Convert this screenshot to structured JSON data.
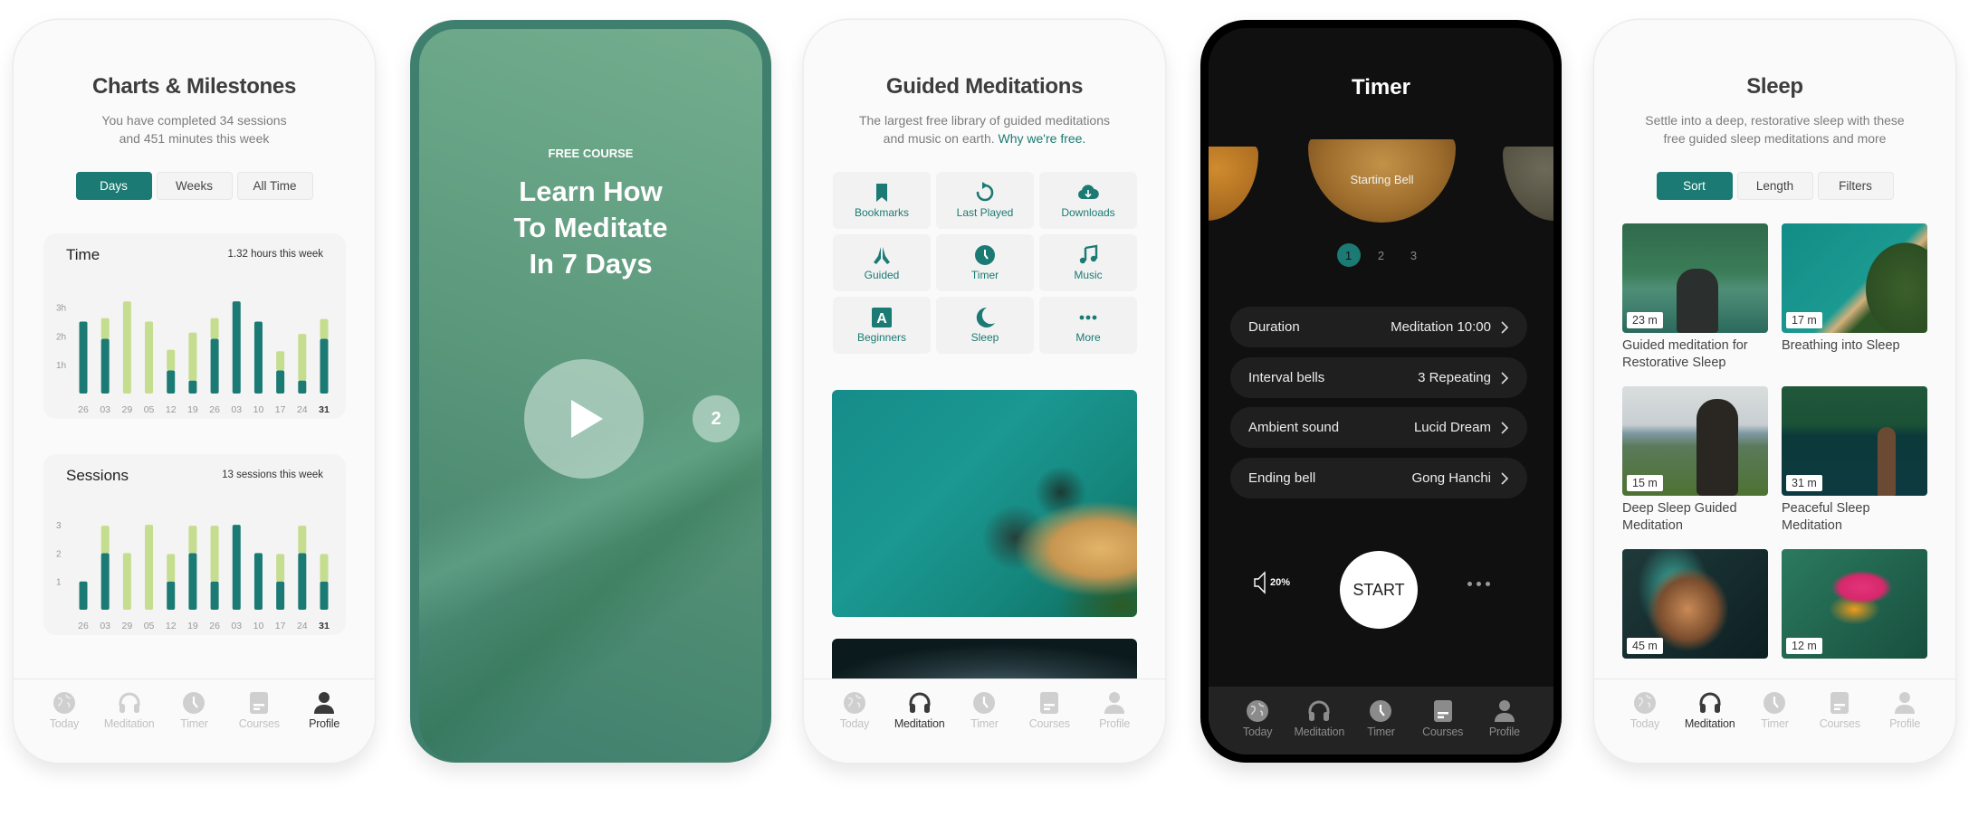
{
  "tabbar": {
    "items": [
      {
        "label": "Today",
        "icon": "globe-icon"
      },
      {
        "label": "Meditation",
        "icon": "headphones-icon"
      },
      {
        "label": "Timer",
        "icon": "clock-icon"
      },
      {
        "label": "Courses",
        "icon": "courses-icon"
      },
      {
        "label": "Profile",
        "icon": "profile-icon"
      }
    ]
  },
  "charts_screen": {
    "title": "Charts & Milestones",
    "subtitle_line1": "You have completed 34 sessions",
    "subtitle_line2": "and 451 minutes this week",
    "segments": [
      "Days",
      "Weeks",
      "All Time"
    ],
    "active_segment": "Days",
    "active_tab": "Profile"
  },
  "chart_data": [
    {
      "type": "bar",
      "title": "Time",
      "annotation": "1.32 hours this week",
      "categories": [
        "26",
        "03",
        "29",
        "05",
        "12",
        "19",
        "26",
        "03",
        "10",
        "17",
        "24",
        "31"
      ],
      "highlight_category_index": 11,
      "stacked": true,
      "yticks": [
        "1h",
        "2h",
        "3h"
      ],
      "ylim": [
        0,
        3.3
      ],
      "series": [
        {
          "name": "dark",
          "color": "#1b7a73",
          "values": [
            2.5,
            1.9,
            0,
            0,
            0.8,
            0.45,
            1.9,
            3.2,
            2.5,
            0.8,
            0.45,
            1.9
          ]
        },
        {
          "name": "light",
          "color": "#c5dd8e",
          "values": [
            0,
            0.75,
            3.2,
            2.5,
            0.75,
            1.7,
            0.75,
            0,
            0,
            0.7,
            1.65,
            0.72
          ]
        }
      ],
      "xlabel": "",
      "ylabel": ""
    },
    {
      "type": "bar",
      "title": "Sessions",
      "annotation": "13 sessions this week",
      "categories": [
        "26",
        "03",
        "29",
        "05",
        "12",
        "19",
        "26",
        "03",
        "10",
        "17",
        "24",
        "31"
      ],
      "highlight_category_index": 11,
      "stacked": true,
      "yticks": [
        "1",
        "2",
        "3"
      ],
      "ylim": [
        0,
        3.1
      ],
      "series": [
        {
          "name": "dark",
          "color": "#1b7a73",
          "values": [
            1,
            2,
            0,
            0,
            1,
            2,
            1,
            3,
            2,
            1,
            2,
            1
          ]
        },
        {
          "name": "light",
          "color": "#c5dd8e",
          "values": [
            0,
            1,
            2,
            3,
            1,
            1,
            2,
            0,
            0,
            1,
            1,
            1
          ]
        }
      ],
      "xlabel": "",
      "ylabel": ""
    }
  ],
  "course_screen": {
    "eyebrow": "FREE COURSE",
    "title_lines": [
      "Learn How",
      "To Meditate",
      "In 7 Days"
    ],
    "next_badge": "2",
    "play_icon": "play-icon"
  },
  "guided_screen": {
    "title": "Guided Meditations",
    "subtitle_line1": "The largest free library of guided meditations",
    "subtitle_line2": "and music on earth.",
    "link": "Why we're free.",
    "categories": [
      {
        "label": "Bookmarks",
        "icon": "bookmark-icon"
      },
      {
        "label": "Last Played",
        "icon": "history-icon"
      },
      {
        "label": "Downloads",
        "icon": "cloud-download-icon"
      },
      {
        "label": "Guided",
        "icon": "praying-hands-icon"
      },
      {
        "label": "Timer",
        "icon": "clock-icon"
      },
      {
        "label": "Music",
        "icon": "music-note-icon"
      },
      {
        "label": "Beginners",
        "icon": "letter-a-icon"
      },
      {
        "label": "Sleep",
        "icon": "moon-icon"
      },
      {
        "label": "More",
        "icon": "more-icon"
      }
    ],
    "active_tab": "Meditation"
  },
  "timer_screen": {
    "title": "Timer",
    "bell_label": "Starting Bell",
    "pager": [
      "1",
      "2",
      "3"
    ],
    "active_page": "1",
    "settings": [
      {
        "label": "Duration",
        "value": "Meditation 10:00"
      },
      {
        "label": "Interval bells",
        "value": "3 Repeating"
      },
      {
        "label": "Ambient sound",
        "value": "Lucid Dream"
      },
      {
        "label": "Ending bell",
        "value": "Gong Hanchi"
      }
    ],
    "volume": "20%",
    "start_label": "START",
    "active_tab": "Timer"
  },
  "sleep_screen": {
    "title": "Sleep",
    "subtitle_line1": "Settle into a deep, restorative sleep with these",
    "subtitle_line2": "free guided sleep meditations and more",
    "segments": [
      "Sort",
      "Length",
      "Filters"
    ],
    "active_segment": "Sort",
    "items": [
      {
        "duration": "23 m",
        "title": "Guided meditation for Restorative Sleep"
      },
      {
        "duration": "17 m",
        "title": "Breathing into Sleep"
      },
      {
        "duration": "15 m",
        "title": "Deep Sleep Guided Meditation"
      },
      {
        "duration": "31 m",
        "title": "Peaceful Sleep Meditation"
      },
      {
        "duration": "45 m",
        "title": ""
      },
      {
        "duration": "12 m",
        "title": ""
      }
    ],
    "active_tab": "Meditation"
  },
  "colors": {
    "accent": "#1b7a73",
    "accent_light": "#c5dd8e",
    "course_green": "#3f7f6d",
    "timer_bg": "#101010"
  }
}
